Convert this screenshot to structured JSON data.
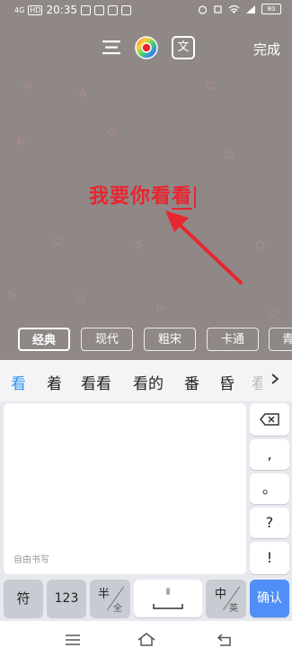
{
  "status_bar": {
    "network": "4G",
    "hd_badge": "HD",
    "time": "20:35",
    "battery": "80"
  },
  "toolbar": {
    "done_label": "完成",
    "text_tool_label": "文"
  },
  "editor": {
    "typed_text": "我要你看",
    "composing_text": "看"
  },
  "text_styles": {
    "items": [
      "经典",
      "现代",
      "粗宋",
      "卡通",
      "青"
    ],
    "selected": "经典"
  },
  "candidates": {
    "items": [
      "看",
      "着",
      "看看",
      "看的",
      "番",
      "昏",
      "看"
    ]
  },
  "keyboard": {
    "handwriting_hint": "自由书写",
    "side_keys": [
      ",",
      "。",
      "?",
      "!"
    ],
    "bottom_row": {
      "symbol": "符",
      "numbers": "123",
      "half": "半",
      "full": "全",
      "zh": "中",
      "en": "英",
      "confirm": "确认"
    }
  },
  "colors": {
    "editor_bg": "#8f8887",
    "text_color": "#e8262f",
    "candidate_highlight": "#2c8ff5",
    "confirm_key": "#4f8ff7"
  }
}
